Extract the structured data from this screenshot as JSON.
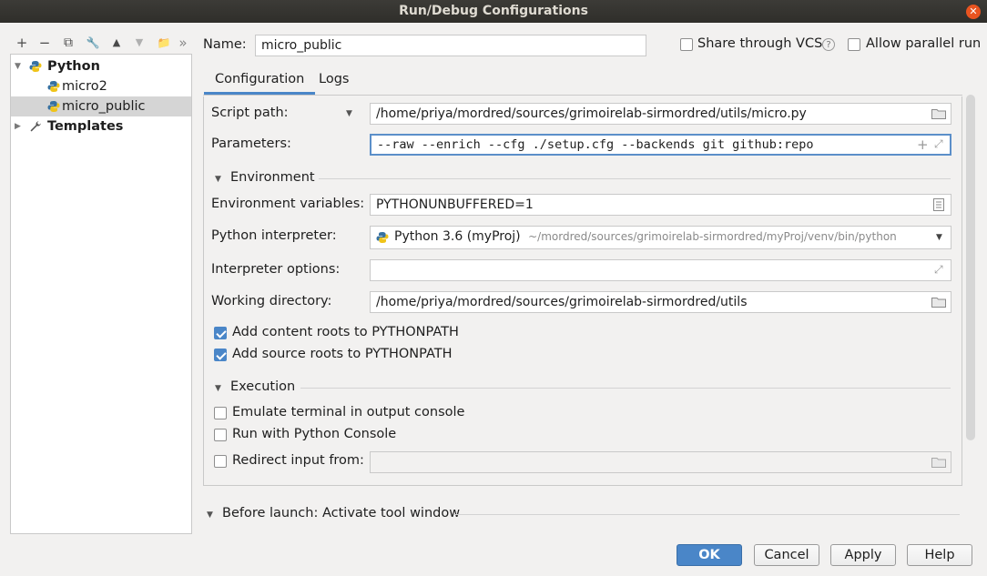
{
  "window": {
    "title": "Run/Debug Configurations",
    "close_glyph": "✕"
  },
  "toolbar": {
    "add": "+",
    "remove": "−",
    "copy": "⧉",
    "edit": "🔧",
    "up": "▲",
    "down": "▼",
    "folder": "📁",
    "more": "»"
  },
  "tree": {
    "items": [
      {
        "label": "Python",
        "bold": true,
        "expanded": true
      },
      {
        "label": "micro2"
      },
      {
        "label": "micro_public",
        "selected": true
      },
      {
        "label": "Templates",
        "bold": true,
        "expanded": false
      }
    ]
  },
  "header": {
    "name_label": "Name:",
    "name_value": "micro_public",
    "share_label": "Share through VCS",
    "help_glyph": "?",
    "parallel_label": "Allow parallel run",
    "share_checked": false,
    "parallel_checked": false
  },
  "tabs": [
    {
      "label": "Configuration",
      "active": true
    },
    {
      "label": "Logs",
      "active": false
    }
  ],
  "config": {
    "script_path_label": "Script path:",
    "script_path_value": "/home/priya/mordred/sources/grimoirelab-sirmordred/utils/micro.py",
    "parameters_label": "Parameters:",
    "parameters_value": "--raw --enrich --cfg ./setup.cfg --backends git github:repo",
    "environment_section": "Environment",
    "env_vars_label": "Environment variables:",
    "env_vars_value": "PYTHONUNBUFFERED=1",
    "interpreter_label": "Python interpreter:",
    "interpreter_name": "Python 3.6 (myProj)",
    "interpreter_path": "~/mordred/sources/grimoirelab-sirmordred/myProj/venv/bin/python",
    "interp_options_label": "Interpreter options:",
    "interp_options_value": "",
    "workdir_label": "Working directory:",
    "workdir_value": "/home/priya/mordred/sources/grimoirelab-sirmordred/utils",
    "content_roots_label": "Add content roots to PYTHONPATH",
    "source_roots_label": "Add source roots to PYTHONPATH",
    "execution_section": "Execution",
    "emulate_terminal_label": "Emulate terminal in output console",
    "python_console_label": "Run with Python Console",
    "redirect_label": "Redirect input from:",
    "redirect_value": ""
  },
  "before_launch": {
    "label": "Before launch: Activate tool window"
  },
  "buttons": {
    "ok": "OK",
    "cancel": "Cancel",
    "apply": "Apply",
    "help": "Help"
  },
  "colors": {
    "accent": "#4a86c8",
    "titlebar": "#3c3b37",
    "close": "#e95420"
  }
}
